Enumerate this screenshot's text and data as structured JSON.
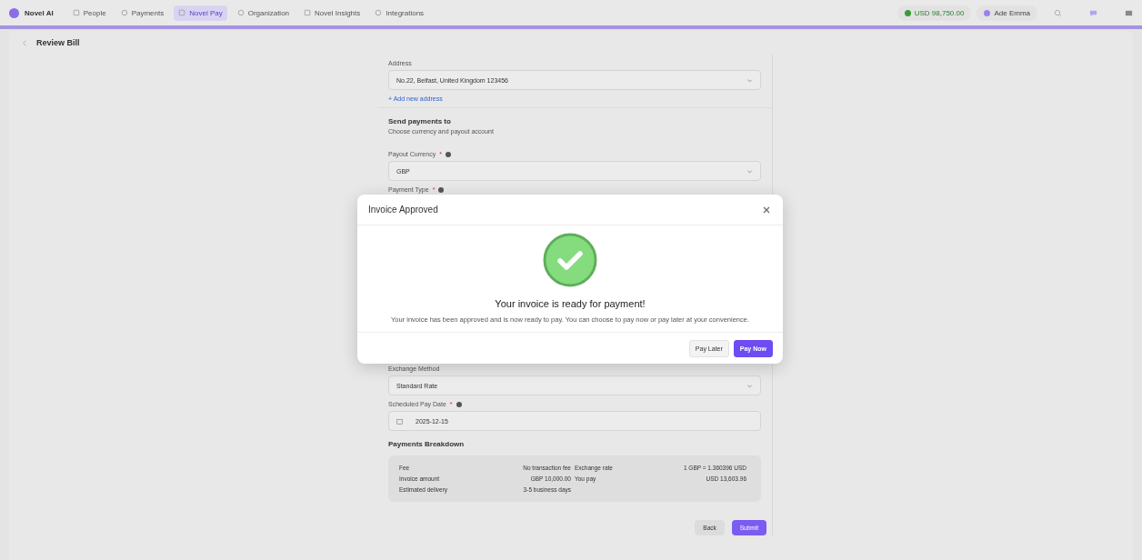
{
  "top_bar": {
    "brand": "Novel AI",
    "nav": [
      {
        "label": "People",
        "selected": false
      },
      {
        "label": "Payments",
        "selected": false
      },
      {
        "label": "Novel Pay",
        "selected": true
      },
      {
        "label": "Organization",
        "selected": false
      },
      {
        "label": "Novel Insights",
        "selected": false
      },
      {
        "label": "Integrations",
        "selected": false
      }
    ],
    "balance": "USD 98,750.00",
    "user": "Ade Emma"
  },
  "page": {
    "title": "Review Bill"
  },
  "form": {
    "address": {
      "label": "Address",
      "value": "No.22, Belfast, United Kingdom 123456",
      "link": "+ Add new address"
    },
    "section": {
      "title": "Send payments to",
      "subtitle": "Choose currency and payout account"
    },
    "fields": [
      {
        "kind": "select",
        "label": "Payout Currency",
        "required_mark": "*",
        "info": true,
        "value": "GBP"
      },
      {
        "kind": "covered",
        "label": "Payment Type",
        "required_mark": "*",
        "info": true
      },
      {
        "kind": "select",
        "label": "Exchange Method",
        "info": false,
        "value": "Standard Rate"
      },
      {
        "kind": "date",
        "label": "Scheduled Pay Date",
        "required_mark": "*",
        "info": true,
        "value": "2025-12-15"
      }
    ],
    "breakdown": {
      "title": "Payments Breakdown",
      "rows": [
        {
          "label": "Fee",
          "value": "No transaction fee",
          "label_2": "Exchange rate",
          "value_2": "1 GBP = 1.360396 USD"
        },
        {
          "label": "Invoice amount",
          "value": "GBP 10,000.00",
          "label_2": "You pay",
          "value_2": "USD 13,603.96"
        },
        {
          "label": "Estimated delivery",
          "value": "3-5 business days"
        }
      ]
    },
    "actions": [
      {
        "label": "Back",
        "kind": "secondary"
      },
      {
        "label": "Submit",
        "kind": "primary"
      }
    ]
  },
  "modal": {
    "title": "Invoice Approved",
    "heading": "Your invoice is ready for payment!",
    "message": "Your invoice has been approved and is now ready to pay. You can choose to pay now or pay later at your convenience.",
    "buttons": [
      {
        "label": "Pay Later",
        "kind": "secondary"
      },
      {
        "label": "Pay Now",
        "kind": "primary"
      }
    ]
  }
}
